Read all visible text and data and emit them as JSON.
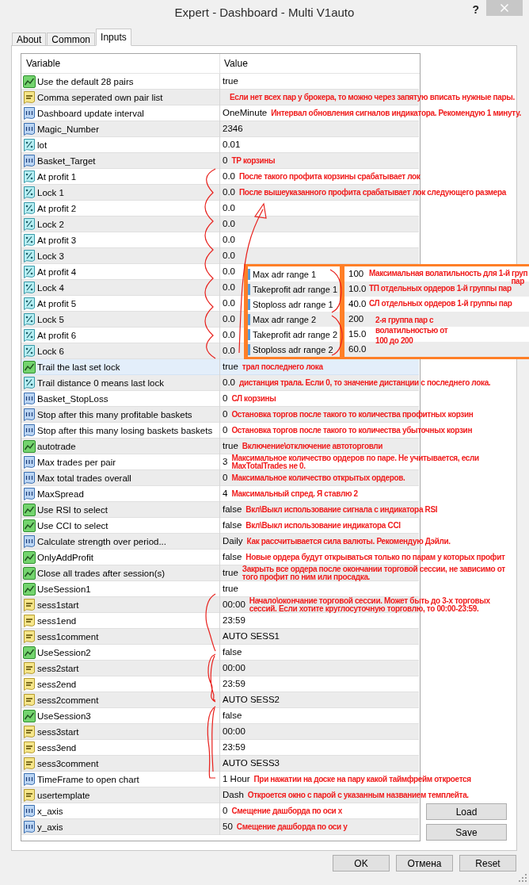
{
  "window": {
    "title": "Expert - Dashboard - Multi V1auto",
    "help": "?"
  },
  "tabs": [
    {
      "label": "About",
      "selected": false
    },
    {
      "label": "Common",
      "selected": false
    },
    {
      "label": "Inputs",
      "selected": true
    }
  ],
  "table": {
    "columns": [
      "Variable",
      "Value"
    ],
    "rows": [
      {
        "kind": "bool",
        "name": "Use the default 28 pairs",
        "value": "true",
        "selected": false
      },
      {
        "kind": "string",
        "name": "Comma seperated own pair list",
        "note": "Если нет всех пар у брокера, то можно через запятую вписать нужные пары.",
        "selected": false
      },
      {
        "kind": "int",
        "name": "Dashboard update interval",
        "value": "OneMinute",
        "note": "Интервал обновления сигналов индикатора. Рекомендую 1 минуту.",
        "selected": false
      },
      {
        "kind": "int",
        "name": "Magic_Number",
        "value": "2346",
        "selected": false
      },
      {
        "kind": "double",
        "name": "lot",
        "value": "0.01",
        "selected": false
      },
      {
        "kind": "int",
        "name": "Basket_Target",
        "value": "0",
        "note": "ТР корзины",
        "selected": false
      },
      {
        "kind": "double",
        "name": "At profit 1",
        "value": "0.0",
        "note": "После такого профита корзины срабатывает лок",
        "selected": false
      },
      {
        "kind": "double",
        "name": "Lock 1",
        "value": "0.0",
        "note": "После вышеуказанного профита срабатывает лок следующего размера",
        "selected": false
      },
      {
        "kind": "double",
        "name": "At profit 2",
        "value": "0.0",
        "selected": false
      },
      {
        "kind": "double",
        "name": "Lock 2",
        "value": "0.0",
        "selected": false
      },
      {
        "kind": "double",
        "name": "At profit 3",
        "value": "0.0",
        "selected": false
      },
      {
        "kind": "double",
        "name": "Lock 3",
        "value": "0.0",
        "selected": false
      },
      {
        "kind": "double",
        "name": "At profit 4",
        "value": "0.0",
        "selected": false
      },
      {
        "kind": "double",
        "name": "Lock 4",
        "value": "0.0",
        "selected": false
      },
      {
        "kind": "double",
        "name": "At profit 5",
        "value": "0.0",
        "selected": false
      },
      {
        "kind": "double",
        "name": "Lock 5",
        "value": "0.0",
        "selected": false
      },
      {
        "kind": "double",
        "name": "At profit 6",
        "value": "0.0",
        "selected": false
      },
      {
        "kind": "double",
        "name": "Lock 6",
        "value": "0.0",
        "selected": false
      },
      {
        "kind": "bool",
        "name": "Trail the last set lock",
        "value": "true",
        "note": "трал последнего лока",
        "selected": true
      },
      {
        "kind": "double",
        "name": "Trail distance 0 means last lock",
        "value": "0.0",
        "note": "дистанция трала. Если 0, то значение дистанции с последнего лока.",
        "selected": false
      },
      {
        "kind": "int",
        "name": "Basket_StopLoss",
        "value": "0",
        "note": "СЛ корзины",
        "selected": false
      },
      {
        "kind": "int",
        "name": "Stop after this many profitable baskets",
        "value": "0",
        "note": "Остановка торгов после такого то количества профитных корзин",
        "selected": false
      },
      {
        "kind": "int",
        "name": "Stop after this many losing baskets baskets",
        "value": "0",
        "note": "Остановка торгов после такого то количества убыточных корзин",
        "selected": false
      },
      {
        "kind": "bool",
        "name": "autotrade",
        "value": "true",
        "note": "Включение\\отключение автоторговли",
        "selected": false
      },
      {
        "kind": "int",
        "name": "Max trades per pair",
        "value": "3",
        "note": "Максимальное количество ордеров по паре. Не учитывается, если\nMaxTotalTrades не 0.",
        "selected": false
      },
      {
        "kind": "int",
        "name": "Max total trades overall",
        "value": "0",
        "note": "Максимальное количество открытых ордеров.",
        "selected": false
      },
      {
        "kind": "int",
        "name": "MaxSpread",
        "value": "4",
        "note": "Максимальный спред. Я ставлю 2",
        "selected": false
      },
      {
        "kind": "bool",
        "name": "Use RSI to select",
        "value": "false",
        "note": "Вкл\\Выкл использование сигнала с индикатора RSI",
        "selected": false
      },
      {
        "kind": "bool",
        "name": "Use CCI to select",
        "value": "false",
        "note": "Вкл\\Выкл использование индикатора CCI",
        "selected": false
      },
      {
        "kind": "int",
        "name": "Calculate strength over period...",
        "value": "Daily",
        "note": "Как рассчитывается сила валюты. Рекомендую Дэйли.",
        "selected": false
      },
      {
        "kind": "bool",
        "name": "OnlyAddProfit",
        "value": "false",
        "note": "Новые ордера будут открываться только по парам у которых профит",
        "selected": false
      },
      {
        "kind": "bool",
        "name": "Close all trades after session(s)",
        "value": "true",
        "note": "Закрыть все ордера после окончании торговой сессии, не зависимо от\nтого профит по ним или просадка.",
        "selected": false
      },
      {
        "kind": "bool",
        "name": "UseSession1",
        "value": "true",
        "selected": false
      },
      {
        "kind": "string",
        "name": "sess1start",
        "value": "00:00",
        "note": "Начало\\окончание торговой сессии. Может быть до 3-х торговых\nсессий. Если хотите круглосуточную торговлю, то 00:00-23:59.",
        "selected": false
      },
      {
        "kind": "string",
        "name": "sess1end",
        "value": "23:59",
        "selected": false
      },
      {
        "kind": "string",
        "name": "sess1comment",
        "value": "AUTO SESS1",
        "selected": false
      },
      {
        "kind": "bool",
        "name": "UseSession2",
        "value": "false",
        "selected": false
      },
      {
        "kind": "string",
        "name": "sess2start",
        "value": "00:00",
        "selected": false
      },
      {
        "kind": "string",
        "name": "sess2end",
        "value": "23:59",
        "selected": false
      },
      {
        "kind": "string",
        "name": "sess2comment",
        "value": "AUTO SESS2",
        "selected": false
      },
      {
        "kind": "bool",
        "name": "UseSession3",
        "value": "false",
        "selected": false
      },
      {
        "kind": "string",
        "name": "sess3start",
        "value": "00:00",
        "selected": false
      },
      {
        "kind": "string",
        "name": "sess3end",
        "value": "23:59",
        "selected": false
      },
      {
        "kind": "string",
        "name": "sess3comment",
        "value": "AUTO SESS3",
        "selected": false
      },
      {
        "kind": "int",
        "name": "TimeFrame to open chart",
        "value": "1 Hour",
        "note": "При нажатии на доске на пару какой таймфрейм откроется",
        "selected": false
      },
      {
        "kind": "string",
        "name": "usertemplate",
        "value": "Dash",
        "note": "Откроется окно с парой с указанным названием темплейта.",
        "selected": false
      },
      {
        "kind": "int",
        "name": "x_axis",
        "value": "0",
        "note": "Смещение дашборда по оси х",
        "selected": false
      },
      {
        "kind": "int",
        "name": "y_axis",
        "value": "50",
        "note": "Смещение дашборда по оси у",
        "selected": false
      }
    ]
  },
  "inset": {
    "rows": [
      {
        "name": "Max adr range 1",
        "value": "100",
        "notes": [
          "Максимальная волатильность для 1-й груп",
          "пар"
        ]
      },
      {
        "name": "Takeprofit adr range 1",
        "value": "10.0",
        "notes": [
          "ТП отдельных ордеров 1-й группы пар"
        ]
      },
      {
        "name": "Stoploss adr range 1",
        "value": "40.0",
        "notes": [
          "СЛ отдельных ордеров 1-й группы пар"
        ]
      },
      {
        "name": "Max adr range 2",
        "value": "200",
        "notes": [
          "2-я группа пар с\nволатильностью от\n100 до 200"
        ]
      },
      {
        "name": "Takeprofit adr range 2",
        "value": "15.0"
      },
      {
        "name": "Stoploss adr range 2",
        "value": "60.0"
      }
    ]
  },
  "side_buttons": [
    "Load",
    "Save"
  ],
  "buttons": [
    "OK",
    "Отмена",
    "Reset"
  ]
}
